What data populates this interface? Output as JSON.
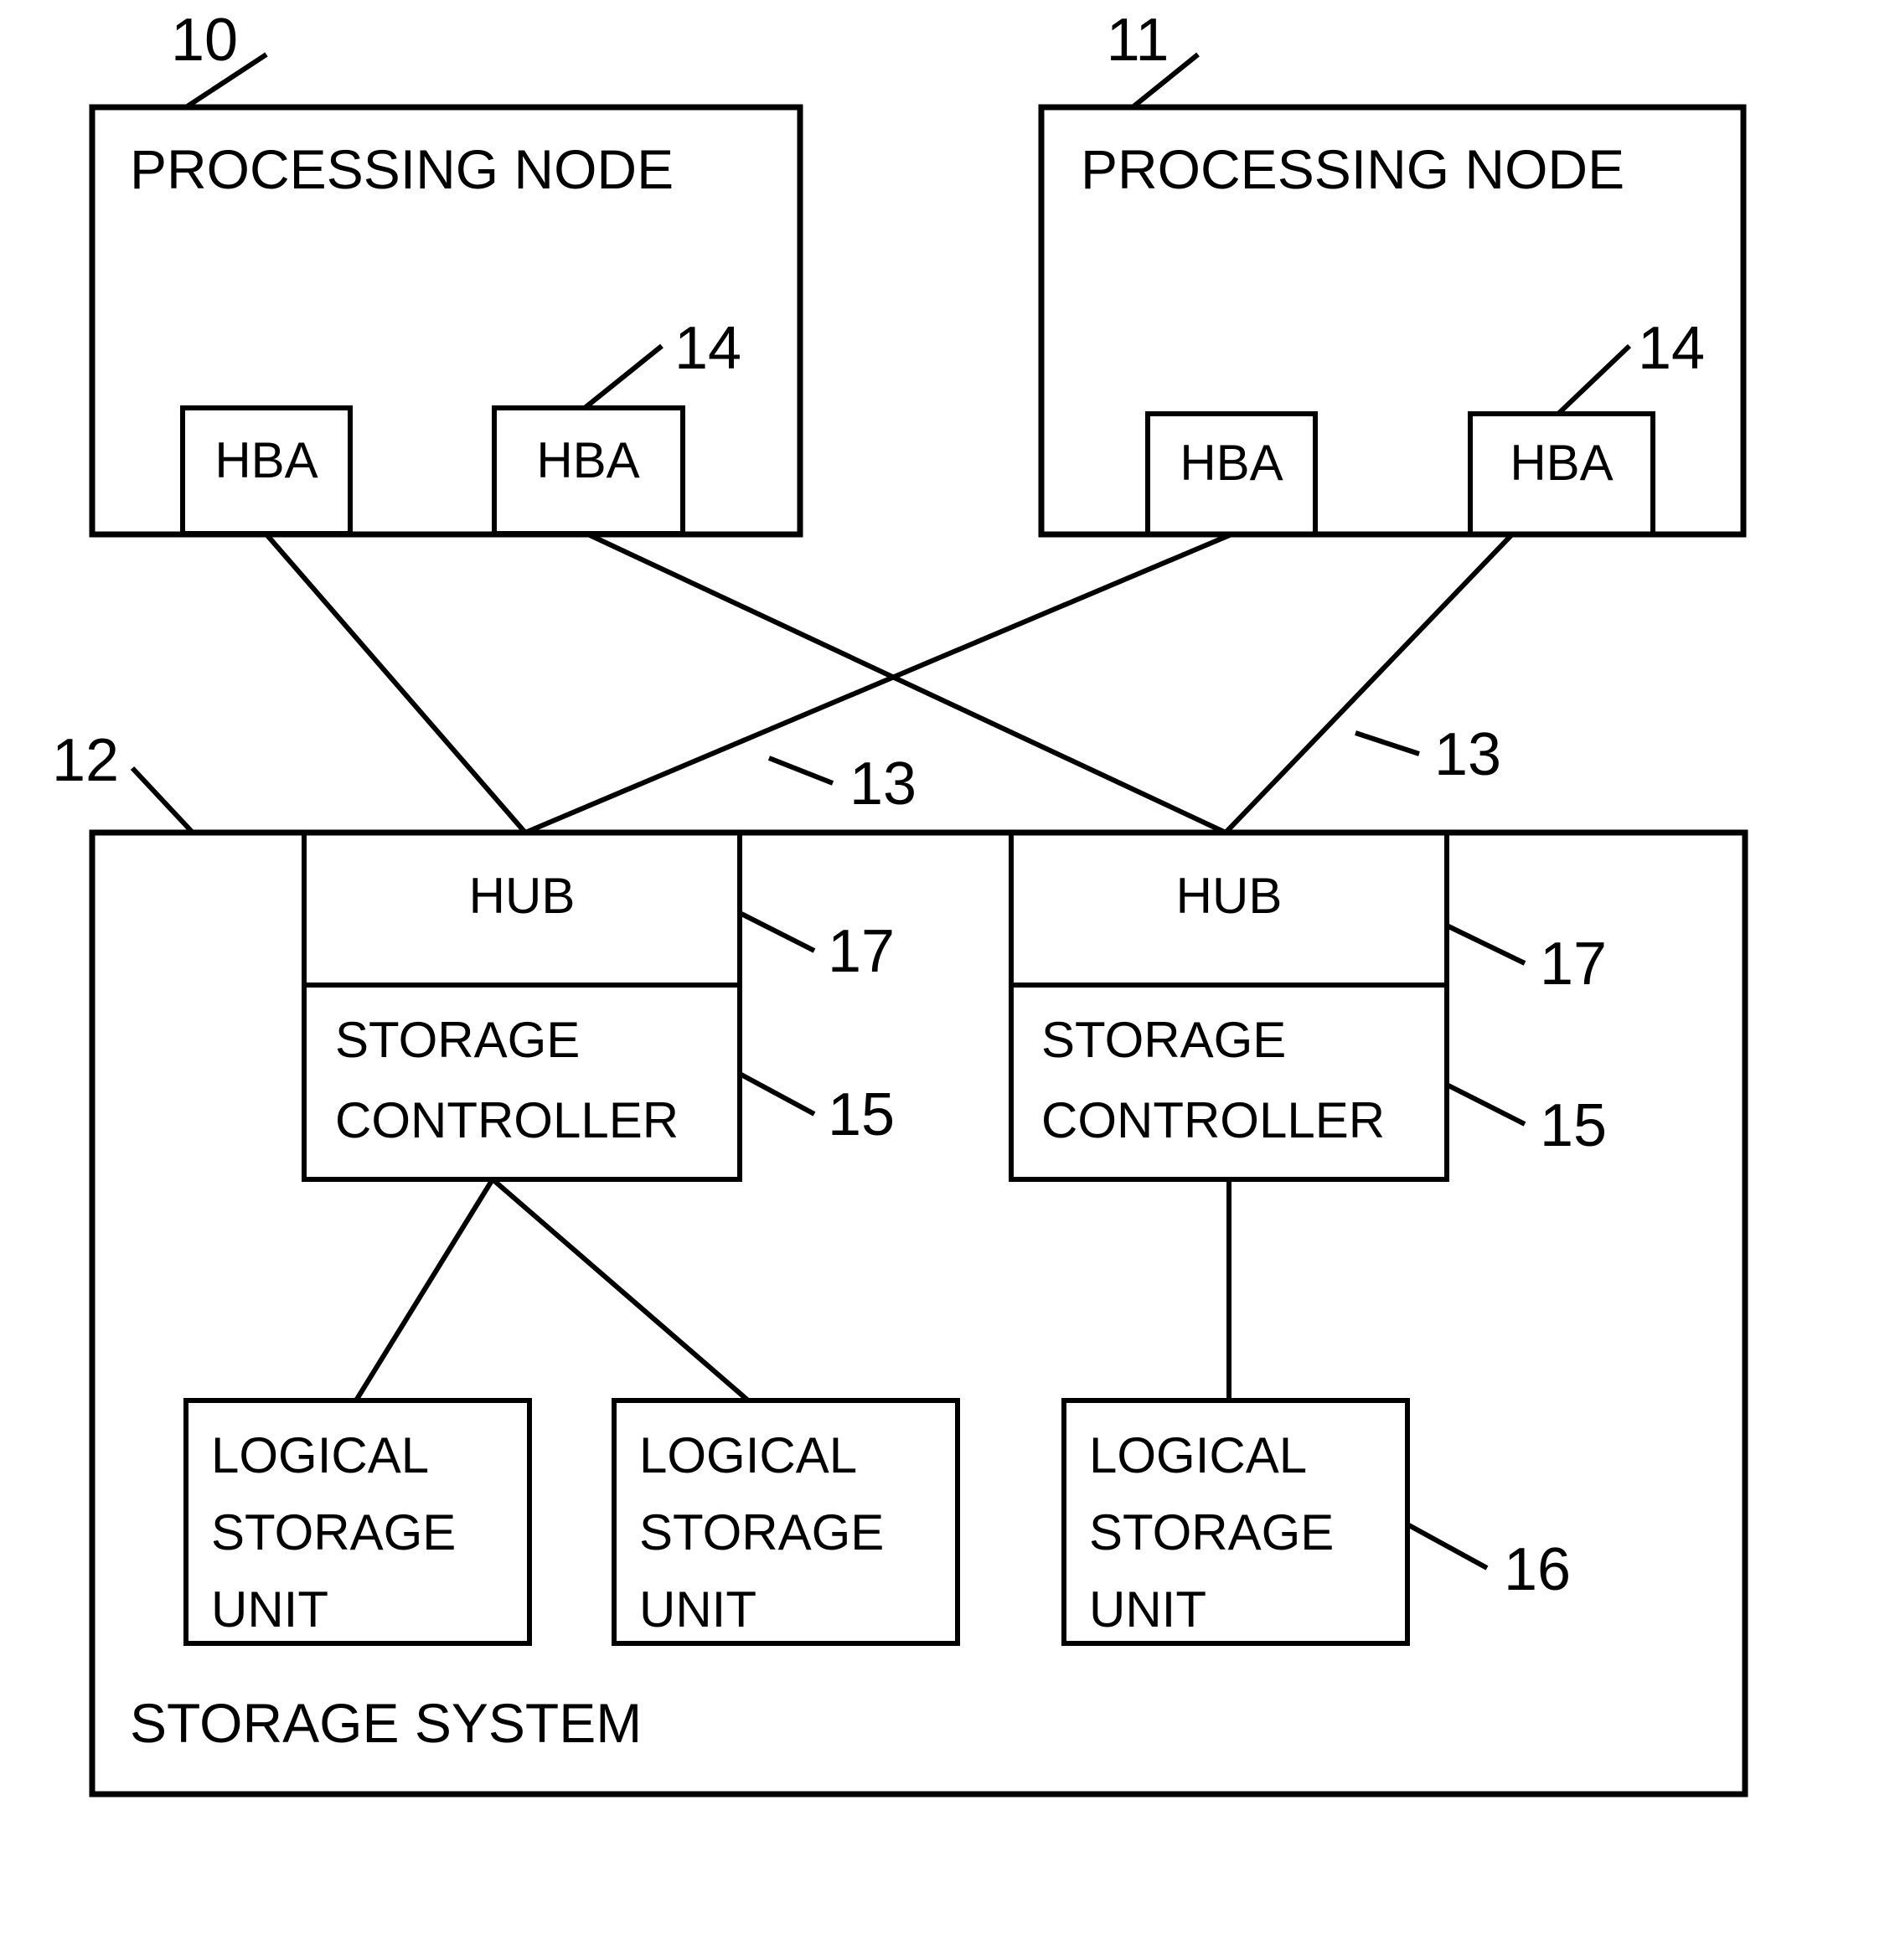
{
  "figure": {
    "type": "patent-block-diagram",
    "background_color": "#ffffff",
    "line_color": "#000000"
  },
  "nodes": {
    "processing_node_left": {
      "label": "PROCESSING NODE",
      "ref": "10",
      "hbas": [
        {
          "label": "HBA",
          "ref": ""
        },
        {
          "label": "HBA",
          "ref": "14"
        }
      ]
    },
    "processing_node_right": {
      "label": "PROCESSING NODE",
      "ref": "11",
      "hbas": [
        {
          "label": "HBA",
          "ref": ""
        },
        {
          "label": "HBA",
          "ref": "14"
        }
      ]
    }
  },
  "storage_system": {
    "label": "STORAGE SYSTEM",
    "ref": "12",
    "controllers": [
      {
        "hub_label": "HUB",
        "hub_ref": "17",
        "controller_label_line1": "STORAGE",
        "controller_label_line2": "CONTROLLER",
        "controller_ref": "15"
      },
      {
        "hub_label": "HUB",
        "hub_ref": "17",
        "controller_label_line1": "STORAGE",
        "controller_label_line2": "CONTROLLER",
        "controller_ref": "15"
      }
    ],
    "logical_storage_units": [
      {
        "line1": "LOGICAL",
        "line2": "STORAGE",
        "line3": "UNIT",
        "ref": ""
      },
      {
        "line1": "LOGICAL",
        "line2": "STORAGE",
        "line3": "UNIT",
        "ref": ""
      },
      {
        "line1": "LOGICAL",
        "line2": "STORAGE",
        "line3": "UNIT",
        "ref": "16"
      }
    ]
  },
  "connections": {
    "fabric_link_ref_left": "13",
    "fabric_link_ref_right": "13"
  },
  "reference_numerals": {
    "n10": "10",
    "n11": "11",
    "n12": "12",
    "n13_left": "13",
    "n13_right": "13",
    "n14_left": "14",
    "n14_right": "14",
    "n15_left": "15",
    "n15_right": "15",
    "n16": "16",
    "n17_left": "17",
    "n17_right": "17"
  }
}
